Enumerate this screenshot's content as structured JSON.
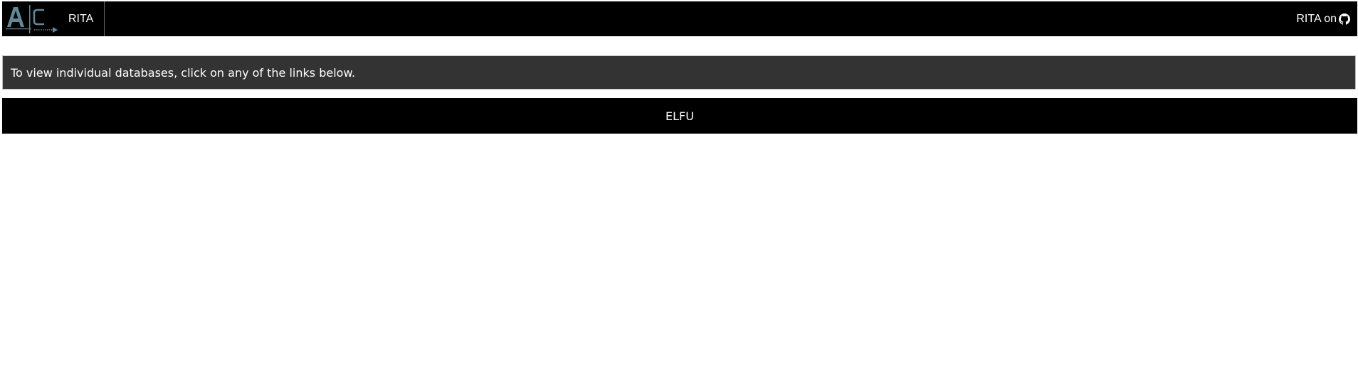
{
  "header": {
    "brand_label": "RITA",
    "github_link_label": "RITA on",
    "logo_icon": "ac-logo-icon",
    "github_icon": "github-icon",
    "logo_colors": {
      "primary": "#5f8a98",
      "background": "#000000"
    }
  },
  "notice": {
    "text": "To view individual databases, click on any of the links below."
  },
  "databases": [
    {
      "label": "ELFU"
    }
  ],
  "colors": {
    "bar": "#000000",
    "notice_bg": "#333333",
    "text": "#ffffff"
  }
}
